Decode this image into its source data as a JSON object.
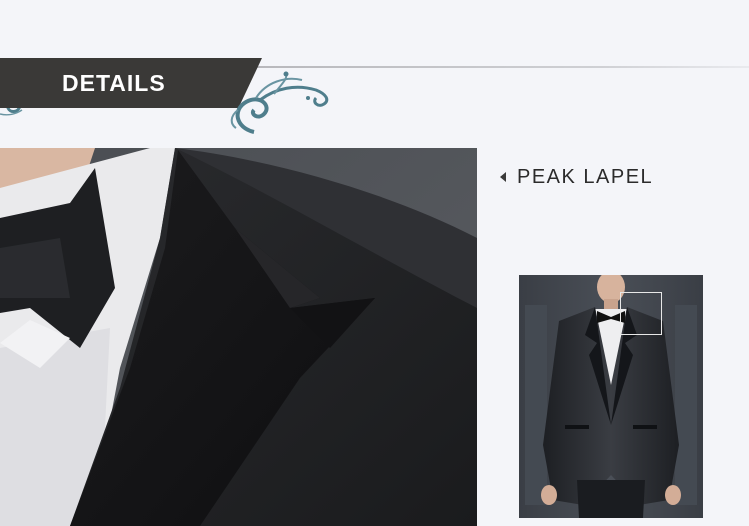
{
  "banner": {
    "label": "DETAILS",
    "accent_color": "#3a3937",
    "ornament_color": "#4f7e8c"
  },
  "detail": {
    "label": "PEAK LAPEL",
    "arrow_icon": "triangle-left-icon"
  },
  "images": {
    "main": "close-up of tuxedo peak lapel with black bow tie",
    "thumbnail": "model wearing black tuxedo with bow tie"
  }
}
